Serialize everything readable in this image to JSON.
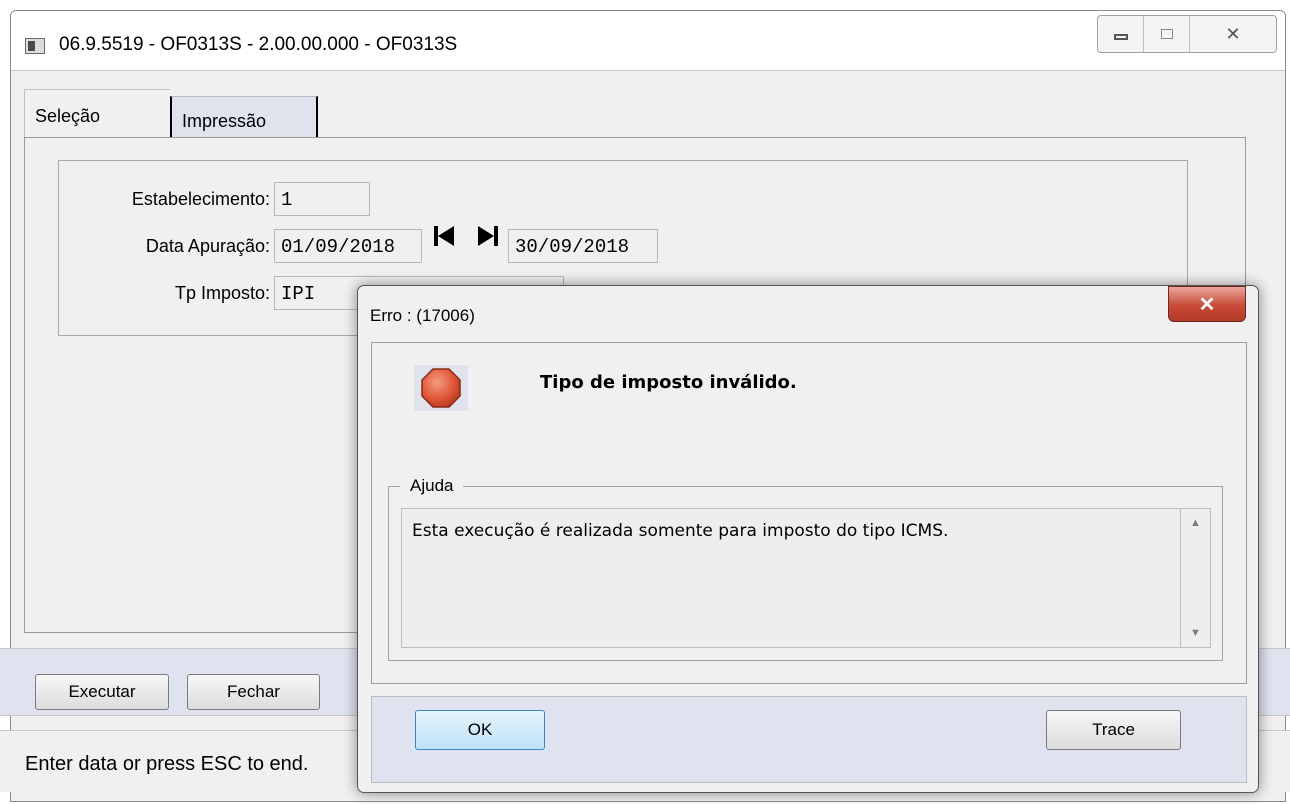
{
  "window": {
    "title": "06.9.5519 - OF0313S - 2.00.00.000 - OF0313S",
    "controls": {
      "minimize": "minimize-icon",
      "maximize": "maximize-icon",
      "close": "✕"
    }
  },
  "tabs": [
    {
      "label": "Seleção",
      "active": true
    },
    {
      "label": "Impressão",
      "active": false
    }
  ],
  "form": {
    "estabelecimento": {
      "label": "Estabelecimento:",
      "value": "1"
    },
    "data_apuracao": {
      "label": "Data Apuração:",
      "value_start": "01/09/2018",
      "value_end": "30/09/2018"
    },
    "tp_imposto": {
      "label": "Tp Imposto:",
      "value": "IPI"
    }
  },
  "buttons": {
    "executar": "Executar",
    "fechar": "Fechar"
  },
  "status": {
    "text": "Enter data or press ESC to end."
  },
  "dialog": {
    "title": "Erro : (17006)",
    "close": "✕",
    "message": "Tipo de imposto inválido.",
    "help_legend": "Ajuda",
    "help_text": "Esta execução é realizada somente para imposto do tipo ICMS.",
    "ok_label": "OK",
    "trace_label": "Trace",
    "colors": {
      "stop": "#e05a3a",
      "close_button": "#c74a36"
    }
  }
}
